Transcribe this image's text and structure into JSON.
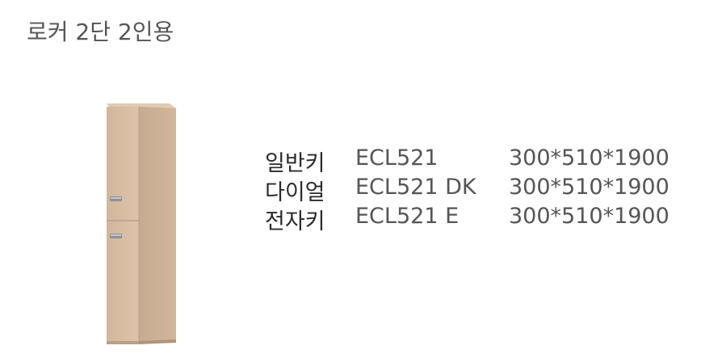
{
  "title": "로커 2단 2인용",
  "product_image": {
    "alt": "locker-2-tier-illustration",
    "colors": {
      "front_panel": "#d6bca2",
      "side_panel": "#c9ae93",
      "top_cap": "#e2cdb6",
      "edge_shadow": "#b89d83",
      "handle": "#8a8f96"
    }
  },
  "specs": [
    {
      "type": "일반키",
      "model": "ECL521",
      "size": "300*510*1900"
    },
    {
      "type": "다이얼",
      "model": "ECL521 DK",
      "size": "300*510*1900"
    },
    {
      "type": "전자키",
      "model": "ECL521 E",
      "size": "300*510*1900"
    }
  ]
}
